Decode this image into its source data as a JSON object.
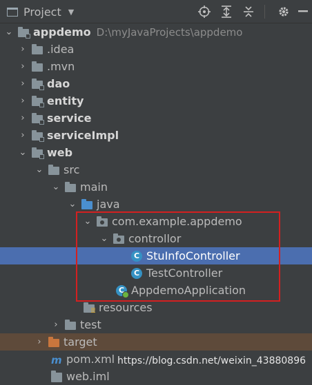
{
  "header": {
    "title": "Project",
    "tools": [
      "locate-icon",
      "expand-all-icon",
      "collapse-all-icon",
      "settings-icon"
    ]
  },
  "tree": {
    "root": {
      "label": "appdemo",
      "path": "D:\\myJavaProjects\\appdemo"
    },
    "idea": ".idea",
    "mvn": ".mvn",
    "dao": "dao",
    "entity": "entity",
    "service": "service",
    "serviceImpl": "serviceImpl",
    "web": "web",
    "src": "src",
    "main": "main",
    "java": "java",
    "pkg": "com.example.appdemo",
    "controller": "controllor",
    "stuinfo": "StuInfoController",
    "testctl": "TestController",
    "app": "AppdemoApplication",
    "resources": "resources",
    "test": "test",
    "target": "target",
    "pom": "pom.xml",
    "webiml": "web.iml"
  },
  "watermark": "https://blog.csdn.net/weixin_43880896",
  "colors": {
    "selection": "#4b6eaf",
    "highlight_box": "#d42020",
    "background": "#3c3f41"
  }
}
